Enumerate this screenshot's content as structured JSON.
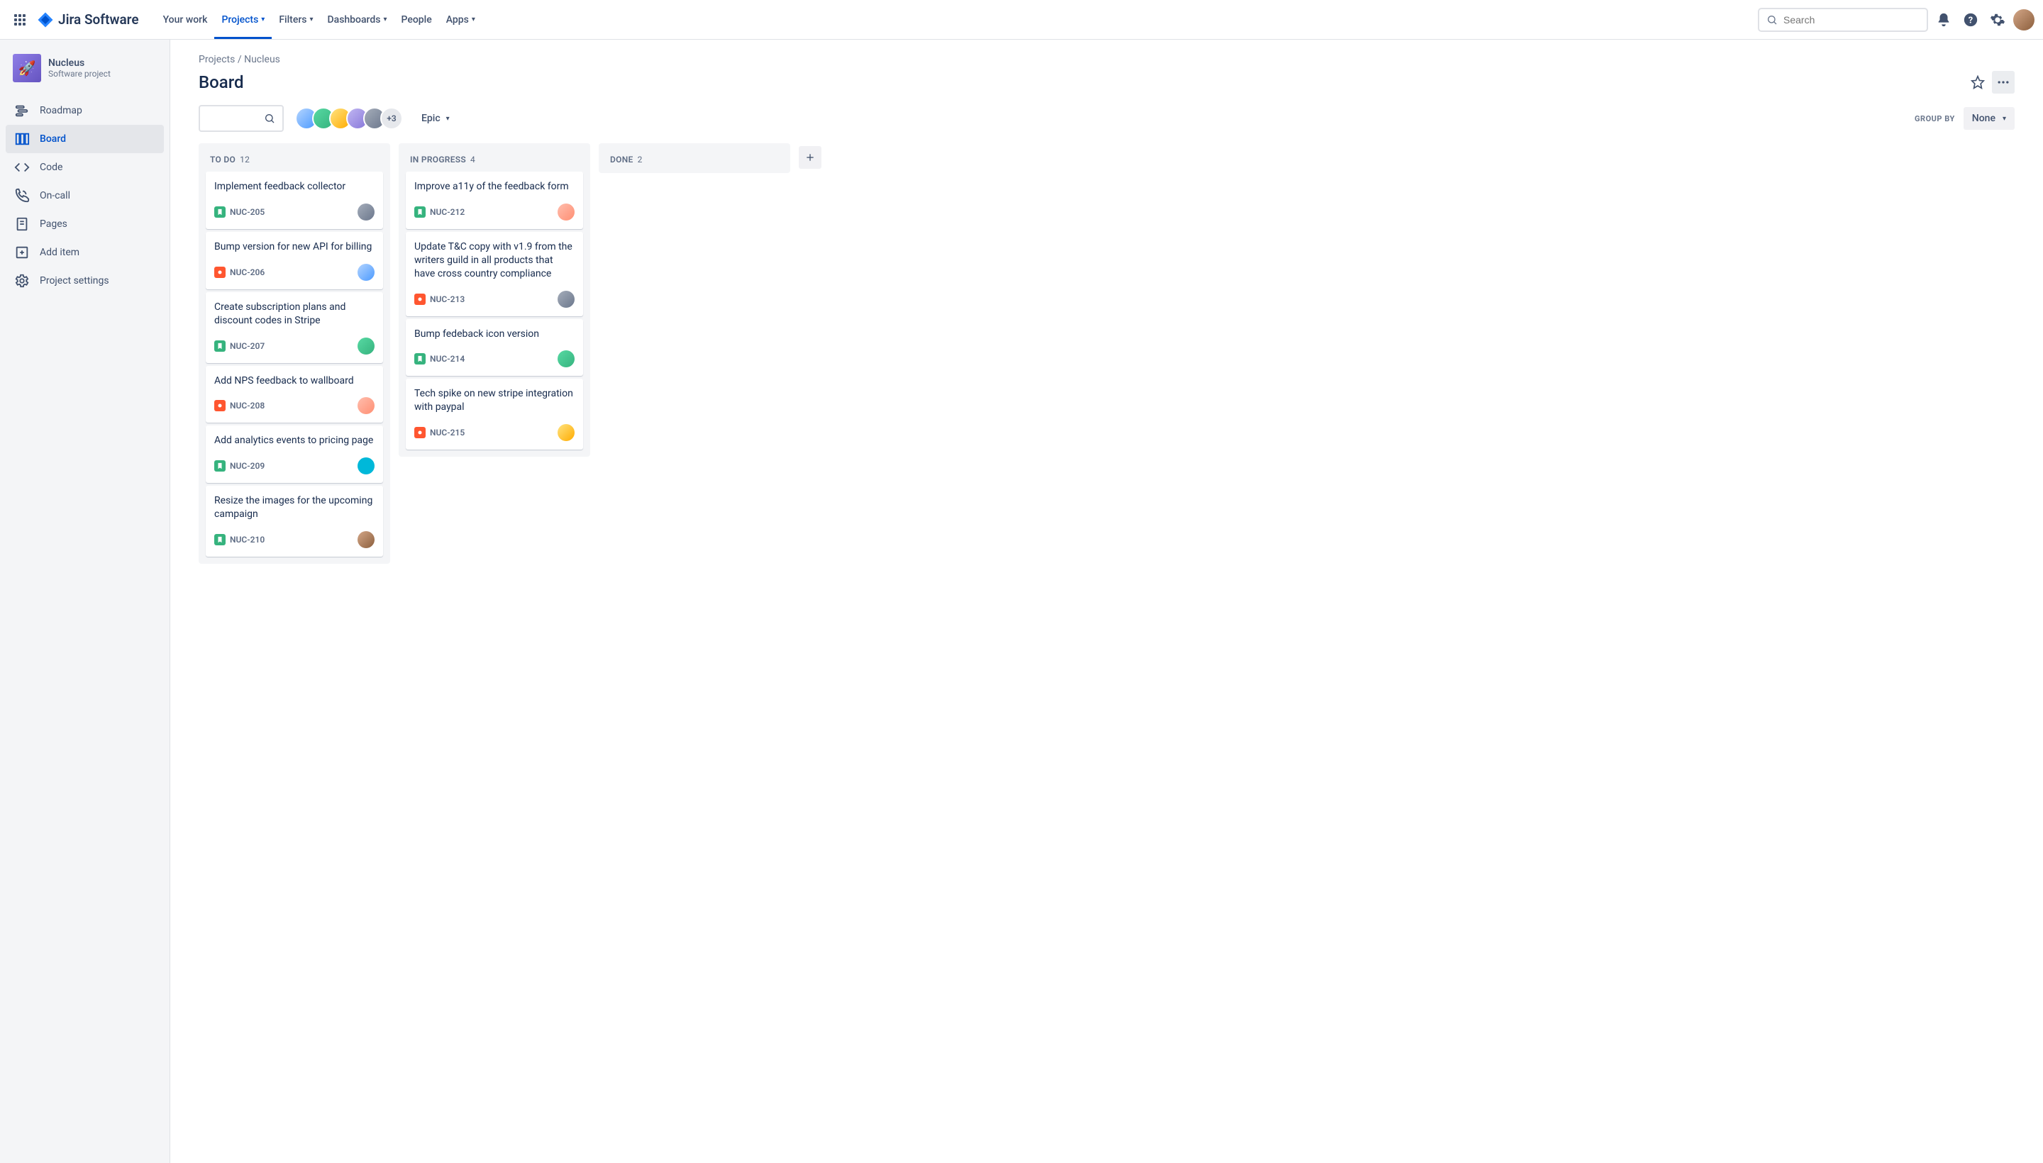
{
  "app_name": "Jira Software",
  "nav": {
    "your_work": "Your work",
    "projects": "Projects",
    "filters": "Filters",
    "dashboards": "Dashboards",
    "people": "People",
    "apps": "Apps"
  },
  "search_placeholder": "Search",
  "project": {
    "name": "Nucleus",
    "subtitle": "Software project"
  },
  "sidebar": {
    "roadmap": "Roadmap",
    "board": "Board",
    "code": "Code",
    "oncall": "On-call",
    "pages": "Pages",
    "add_item": "Add item",
    "settings": "Project settings"
  },
  "breadcrumb": {
    "parent": "Projects",
    "sep": "/",
    "current": "Nucleus"
  },
  "page_title": "Board",
  "filter": {
    "epic_label": "Epic",
    "group_by_label": "GROUP BY",
    "group_by_value": "None",
    "avatar_overflow": "+3"
  },
  "columns": [
    {
      "title": "TO DO",
      "count": "12",
      "cards": [
        {
          "title": "Implement feedback collector",
          "key": "NUC-205",
          "type": "story",
          "av": "av-bg-6"
        },
        {
          "title": "Bump version for new API for billing",
          "key": "NUC-206",
          "type": "bug",
          "av": "av-bg-2"
        },
        {
          "title": "Create subscription plans and discount codes in Stripe",
          "key": "NUC-207",
          "type": "story",
          "av": "av-bg-3"
        },
        {
          "title": "Add NPS feedback to wallboard",
          "key": "NUC-208",
          "type": "bug",
          "av": "av-bg-1"
        },
        {
          "title": "Add analytics events to pricing page",
          "key": "NUC-209",
          "type": "story",
          "av": "av-bg-7"
        },
        {
          "title": "Resize the images for the upcoming campaign",
          "key": "NUC-210",
          "type": "story",
          "av": "av-bg-8"
        }
      ]
    },
    {
      "title": "IN PROGRESS",
      "count": "4",
      "cards": [
        {
          "title": "Improve a11y of the feedback form",
          "key": "NUC-212",
          "type": "story",
          "av": "av-bg-1"
        },
        {
          "title": "Update T&C copy with v1.9 from the writers guild in all products that have cross country compliance",
          "key": "NUC-213",
          "type": "bug",
          "av": "av-bg-6"
        },
        {
          "title": "Bump fedeback icon version",
          "key": "NUC-214",
          "type": "story",
          "av": "av-bg-3"
        },
        {
          "title": "Tech spike on new stripe integration with paypal",
          "key": "NUC-215",
          "type": "bug",
          "av": "av-bg-5"
        }
      ]
    },
    {
      "title": "DONE",
      "count": "2",
      "cards": []
    }
  ]
}
